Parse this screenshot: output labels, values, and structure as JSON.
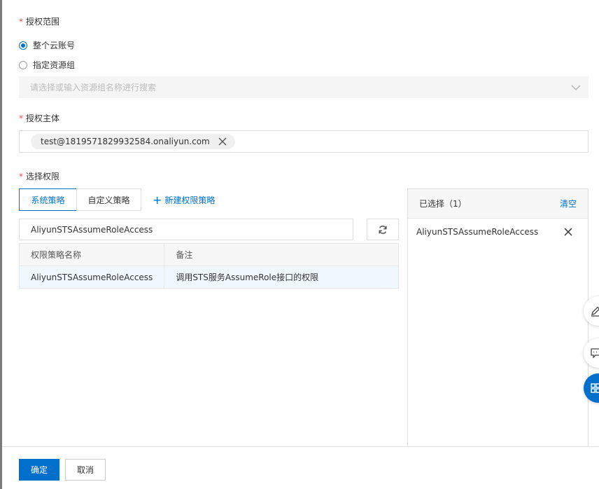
{
  "scope": {
    "required_mark": "*",
    "label": "授权范围",
    "options": [
      {
        "label": "整个云账号",
        "checked": true
      },
      {
        "label": "指定资源组",
        "checked": false
      }
    ],
    "resource_group_placeholder": "请选择或输入资源组名称进行搜索"
  },
  "principal": {
    "required_mark": "*",
    "label": "授权主体",
    "tag": "test@1819571829932584.onaliyun.com"
  },
  "permissions": {
    "required_mark": "*",
    "label": "选择权限",
    "tabs": [
      {
        "label": "系统策略",
        "active": true
      },
      {
        "label": "自定义策略",
        "active": false
      }
    ],
    "new_policy_label": "新建权限策略",
    "search_value": "AliyunSTSAssumeRoleAccess",
    "table": {
      "headers": [
        "权限策略名称",
        "备注"
      ],
      "rows": [
        [
          "AliyunSTSAssumeRoleAccess",
          "调用STS服务AssumeRole接口的权限"
        ]
      ]
    }
  },
  "selected_panel": {
    "title": "已选择（1）",
    "clear_label": "清空",
    "items": [
      "AliyunSTSAssumeRoleAccess"
    ]
  },
  "footer": {
    "confirm_label": "确定",
    "cancel_label": "取消"
  },
  "colors": {
    "accent": "#0070cc",
    "required": "#d9534f"
  },
  "icons": [
    "chevron-down-icon",
    "close-icon",
    "refresh-icon",
    "edit-icon",
    "feedback-icon",
    "apps-icon",
    "plus-icon"
  ]
}
